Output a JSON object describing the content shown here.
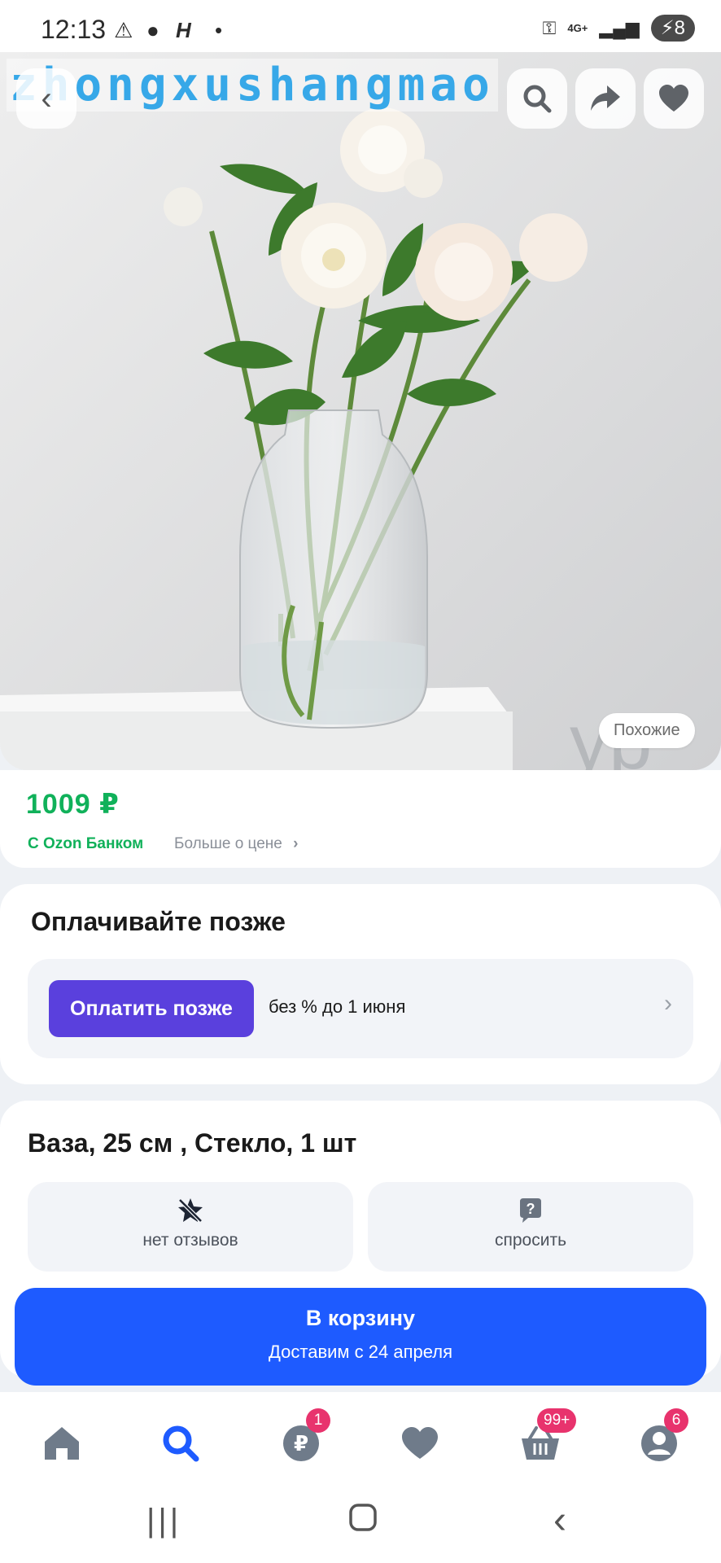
{
  "status_bar": {
    "time": "12:13",
    "network": "4G+",
    "battery": "8"
  },
  "image": {
    "watermark": "zhongxushangmao",
    "similar_label": "Похожие",
    "icons": [
      "back-icon",
      "search-icon",
      "share-icon",
      "heart-icon"
    ]
  },
  "price": {
    "value": "1009 ₽",
    "bank_label": "С Ozon Банком",
    "more_label": "Больше о цене"
  },
  "pay_later": {
    "title": "Оплачивайте позже",
    "button_label": "Оплатить позже",
    "description": "без % до 1 июня"
  },
  "product": {
    "title": "Ваза, 25 см , Стекло, 1 шт",
    "reviews_label": "нет отзывов",
    "ask_label": "спросить"
  },
  "cart": {
    "label": "В корзину",
    "sub_label": "Доставим с 24 апреля"
  },
  "bottom_nav": {
    "items": [
      {
        "icon": "home-icon",
        "badge": ""
      },
      {
        "icon": "search-icon",
        "badge": ""
      },
      {
        "icon": "ruble-icon",
        "badge": "1"
      },
      {
        "icon": "heart-icon",
        "badge": ""
      },
      {
        "icon": "basket-icon",
        "badge": "99+"
      },
      {
        "icon": "profile-icon",
        "badge": "6"
      }
    ]
  },
  "colors": {
    "accent_blue": "#1e5bff",
    "price_green": "#10b15a",
    "pay_later_purple": "#5a40dd",
    "badge_pink": "#e8336d"
  }
}
